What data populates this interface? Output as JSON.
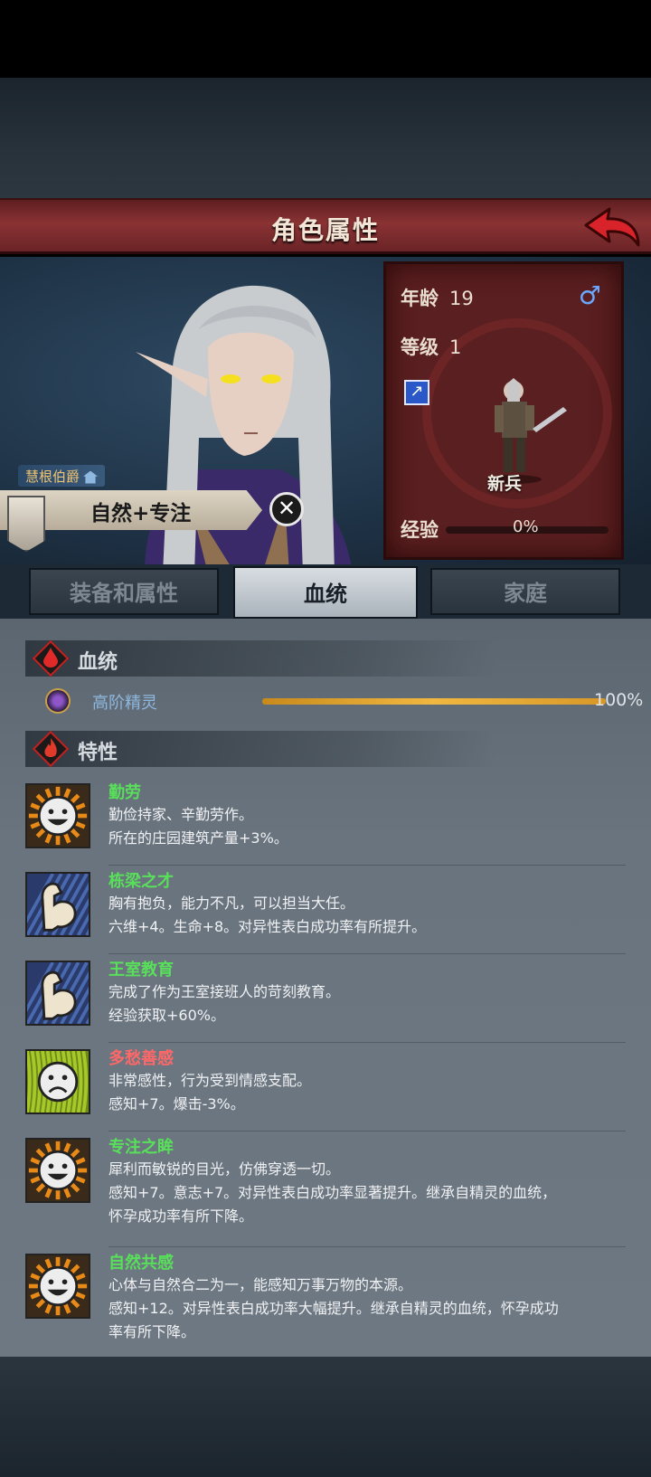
{
  "header": {
    "title": "角色属性"
  },
  "character": {
    "rank_title": "慧根伯爵",
    "focus_banner": "自然+专注",
    "age_label": "年龄",
    "age_value": "19",
    "level_label": "等级",
    "level_value": "1",
    "unit_name": "新兵",
    "exp_label": "经验",
    "exp_value": "0%",
    "gender_symbol": "♂"
  },
  "tabs": [
    {
      "label": "装备和属性",
      "active": false
    },
    {
      "label": "血统",
      "active": true
    },
    {
      "label": "家庭",
      "active": false
    }
  ],
  "bloodline": {
    "section_title": "血统",
    "name": "高阶精灵",
    "percent_text": "100%",
    "percent": 100
  },
  "traits_section": {
    "title": "特性"
  },
  "traits": [
    {
      "name": "勤劳",
      "type": "positive",
      "face": "happy",
      "desc1": "勤俭持家、辛勤劳作。",
      "desc2": "所在的庄园建筑产量+3%。"
    },
    {
      "name": "栋梁之才",
      "type": "positive",
      "face": "muscle",
      "desc1": "胸有抱负，能力不凡，可以担当大任。",
      "desc2": "六维+4。生命+8。对异性表白成功率有所提升。"
    },
    {
      "name": "王室教育",
      "type": "positive",
      "face": "muscle",
      "desc1": "完成了作为王室接班人的苛刻教育。",
      "desc2": "经验获取+60%。"
    },
    {
      "name": "多愁善感",
      "type": "negative",
      "face": "sad",
      "desc1": "非常感性，行为受到情感支配。",
      "desc2": "感知+7。爆击-3%。"
    },
    {
      "name": "专注之眸",
      "type": "positive",
      "face": "happy",
      "desc1": "犀利而敏锐的目光，仿佛穿透一切。",
      "desc2": "感知+7。意志+7。对异性表白成功率显著提升。继承自精灵的血统，",
      "desc3": "怀孕成功率有所下降。"
    },
    {
      "name": "自然共感",
      "type": "positive",
      "face": "happy",
      "desc1": "心体与自然合二为一，能感知万事万物的本源。",
      "desc2": "感知+12。对异性表白成功率大幅提升。继承自精灵的血统，怀孕成功",
      "desc3": "率有所下降。"
    }
  ],
  "colors": {
    "positive": "#58e05a",
    "negative": "#ff6868",
    "title_bar": "#8a3234",
    "bloodline_bar": "#f0b840"
  }
}
